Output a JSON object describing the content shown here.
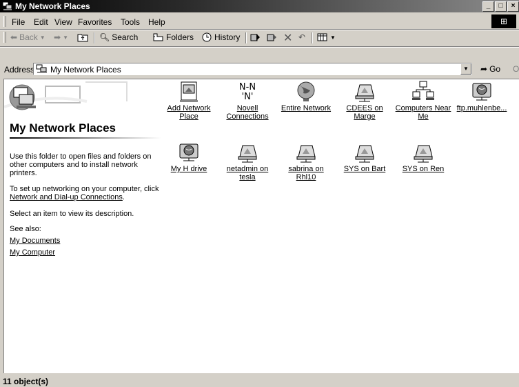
{
  "window": {
    "title": "My Network Places"
  },
  "menu": [
    "File",
    "Edit",
    "View",
    "Favorites",
    "Tools",
    "Help"
  ],
  "toolbar": {
    "back": "Back",
    "forward": "",
    "up": "",
    "search": "Search",
    "folders": "Folders",
    "history": "History"
  },
  "address": {
    "label": "Address",
    "value": "My Network Places",
    "go": "Go",
    "open": "Oper"
  },
  "left_panel": {
    "title": "My Network Places",
    "description": "Use this folder to open files and folders on other computers and to install network printers.",
    "setup_prefix": "To set up networking on your computer, click",
    "setup_link": "Network and Dial-up Connections",
    "setup_suffix": ".",
    "select_hint": "Select an item to view its description.",
    "see_also": "See also:",
    "links": [
      "My Documents",
      "My Computer"
    ]
  },
  "items": [
    {
      "label": "Add Network Place",
      "icon": "add-network-place-icon"
    },
    {
      "label": "Novell Connections",
      "icon": "novell-icon"
    },
    {
      "label": "Entire Network",
      "icon": "globe-icon"
    },
    {
      "label": "CDEES on Marge",
      "icon": "network-folder-icon"
    },
    {
      "label": "Computers Near Me",
      "icon": "computers-icon"
    },
    {
      "label": "ftp.muhlenbe...",
      "icon": "network-drive-icon"
    },
    {
      "label": "My H drive",
      "icon": "network-drive-icon"
    },
    {
      "label": "netadmin on tesla",
      "icon": "network-folder-icon"
    },
    {
      "label": "sabrina on Rhl10",
      "icon": "network-folder-icon"
    },
    {
      "label": "SYS on Bart",
      "icon": "network-folder-icon"
    },
    {
      "label": "SYS on Ren",
      "icon": "network-folder-icon"
    }
  ],
  "status": {
    "text": "11 object(s)"
  }
}
